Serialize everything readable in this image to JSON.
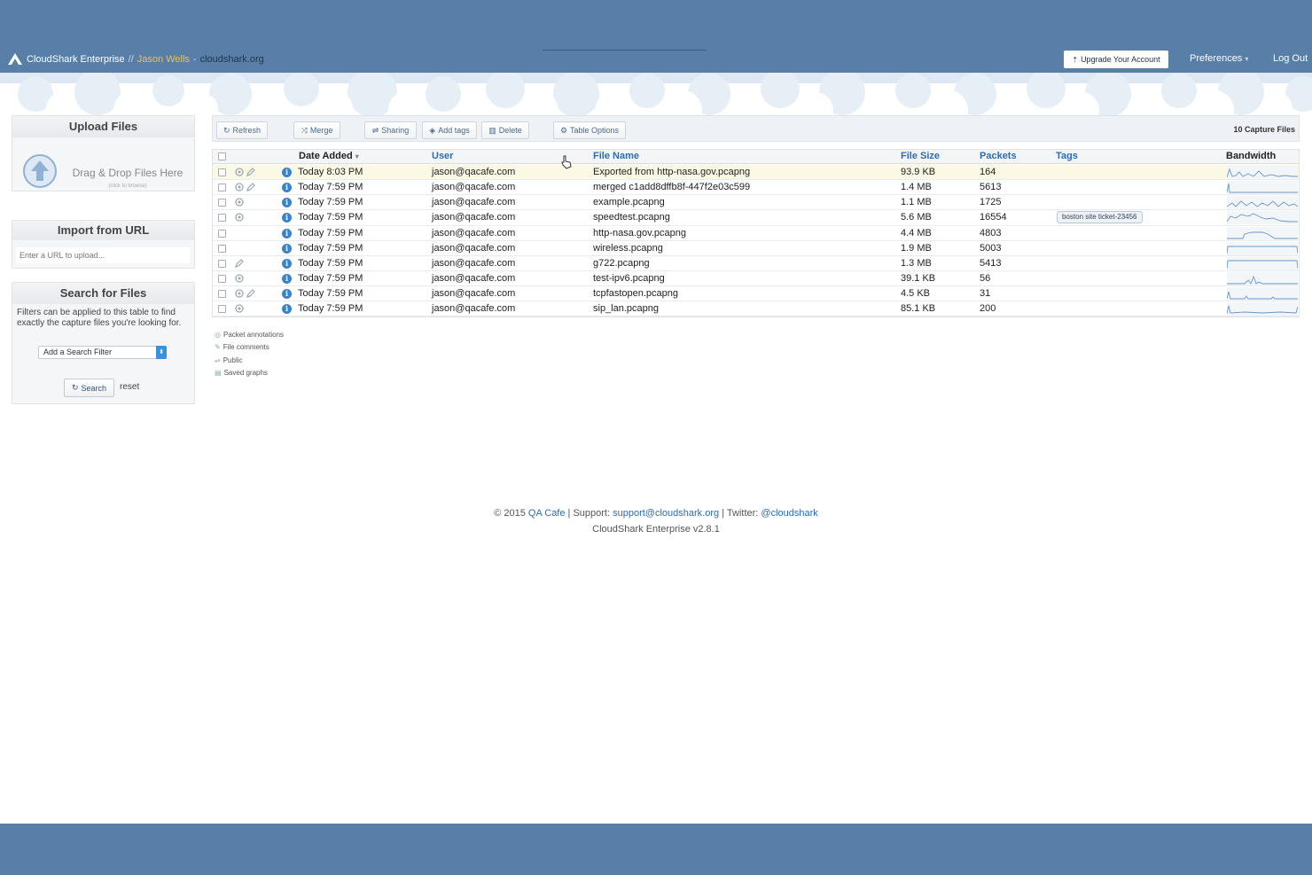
{
  "header": {
    "product": "CloudShark Enterprise",
    "separator": "//",
    "user": "Jason Wells",
    "domain_sep": "-",
    "domain": "cloudshark.org",
    "upgrade_label": "Upgrade Your Account",
    "preferences_label": "Preferences",
    "preferences_caret": "▾",
    "logout_label": "Log Out"
  },
  "sidebar": {
    "upload": {
      "title": "Upload Files",
      "drag_text": "Drag & Drop Files Here",
      "click_text": "(click to browse)"
    },
    "import": {
      "title": "Import from URL",
      "placeholder": "Enter a URL to upload..."
    },
    "search": {
      "title": "Search for Files",
      "description": "Filters can be applied to this table to find exactly the capture files you're looking for.",
      "filter_label": "Add a Search Filter",
      "search_label": "Search",
      "reset_label": "reset"
    }
  },
  "toolbar": {
    "refresh": "Refresh",
    "merge": "Merge",
    "sharing": "Sharing",
    "add_tags": "Add tags",
    "delete": "Delete",
    "table_options": "Table Options",
    "capture_count": "10 Capture Files"
  },
  "table": {
    "columns": {
      "date": "Date Added",
      "date_sort": "▾",
      "user": "User",
      "file_name": "File Name",
      "file_size": "File Size",
      "packets": "Packets",
      "tags": "Tags",
      "bandwidth": "Bandwidth"
    },
    "rows": [
      {
        "date": "Today 8:03 PM",
        "user": "jason@qacafe.com",
        "file": "Exported from http-nasa.gov.pcapng",
        "size": "93.9 KB",
        "packets": "164",
        "tag": ""
      },
      {
        "date": "Today 7:59 PM",
        "user": "jason@qacafe.com",
        "file": "merged c1add8dffb8f-447f2e03c599",
        "size": "1.4 MB",
        "packets": "5613",
        "tag": ""
      },
      {
        "date": "Today 7:59 PM",
        "user": "jason@qacafe.com",
        "file": "example.pcapng",
        "size": "1.1 MB",
        "packets": "1725",
        "tag": ""
      },
      {
        "date": "Today 7:59 PM",
        "user": "jason@qacafe.com",
        "file": "speedtest.pcapng",
        "size": "5.6 MB",
        "packets": "16554",
        "tag": "boston site ticket-23456"
      },
      {
        "date": "Today 7:59 PM",
        "user": "jason@qacafe.com",
        "file": "http-nasa.gov.pcapng",
        "size": "4.4 MB",
        "packets": "4803",
        "tag": ""
      },
      {
        "date": "Today 7:59 PM",
        "user": "jason@qacafe.com",
        "file": "wireless.pcapng",
        "size": "1.9 MB",
        "packets": "5003",
        "tag": ""
      },
      {
        "date": "Today 7:59 PM",
        "user": "jason@qacafe.com",
        "file": "g722.pcapng",
        "size": "1.3 MB",
        "packets": "5413",
        "tag": ""
      },
      {
        "date": "Today 7:59 PM",
        "user": "jason@qacafe.com",
        "file": "test-ipv6.pcapng",
        "size": "39.1 KB",
        "packets": "56",
        "tag": ""
      },
      {
        "date": "Today 7:59 PM",
        "user": "jason@qacafe.com",
        "file": "tcpfastopen.pcapng",
        "size": "4.5 KB",
        "packets": "31",
        "tag": ""
      },
      {
        "date": "Today 7:59 PM",
        "user": "jason@qacafe.com",
        "file": "sip_lan.pcapng",
        "size": "85.1 KB",
        "packets": "200",
        "tag": ""
      }
    ]
  },
  "legend": {
    "annotations": "Packet annotations",
    "comments": "File comments",
    "public": "Public",
    "graphs": "Saved graphs"
  },
  "footer": {
    "copyright": "© 2015",
    "company": "QA Cafe",
    "support_prefix": "| Support:",
    "support_email": "support@cloudshark.org",
    "twitter_prefix": "| Twitter:",
    "twitter": "@cloudshark",
    "version": "CloudShark Enterprise v2.8.1"
  },
  "colors": {
    "header_bg": "#587fa7",
    "link": "#2b6cb5",
    "highlight_row": "#fbf9e3",
    "user_name": "#f1c04a"
  }
}
